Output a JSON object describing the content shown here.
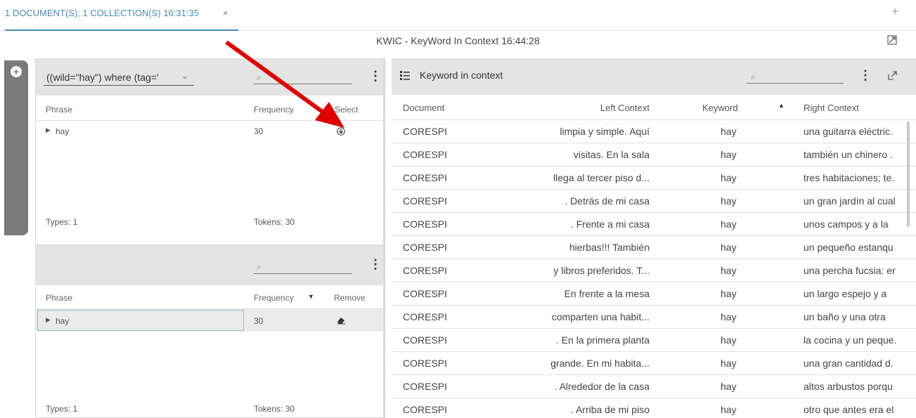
{
  "tab": {
    "label": "1 DOCUMENT(S), 1 COLLECTION(S) 16:31:35",
    "close_symbol": "×",
    "add_symbol": "+"
  },
  "window_title": "KWIC - KeyWord In Context 16:44:28",
  "query_panel": {
    "query_value": "((wild=\"hay\") where (tag='",
    "search_placeholder": "⌕",
    "columns": {
      "phrase": "Phrase",
      "frequency": "Frequency",
      "select": "Select"
    },
    "rows": [
      {
        "phrase": "hay",
        "frequency": "30"
      }
    ],
    "types": "Types: 1",
    "tokens": "Tokens: 30"
  },
  "results_panel": {
    "search_placeholder": "⌕",
    "columns": {
      "phrase": "Phrase",
      "frequency": "Frequency",
      "remove": "Remove"
    },
    "rows": [
      {
        "phrase": "hay",
        "frequency": "30"
      }
    ],
    "types": "Types: 1",
    "tokens": "Tokens: 30"
  },
  "kwic_panel": {
    "title": "Keyword in context",
    "search_placeholder": "⌕",
    "columns": {
      "document": "Document",
      "left": "Left Context",
      "keyword": "Keyword",
      "right": "Right Context"
    },
    "rows": [
      {
        "document": "CORESPI",
        "left": "limpia y simple. Aquí",
        "keyword": "hay",
        "right": "una guitarra eléctric."
      },
      {
        "document": "CORESPI",
        "left": "visitas. En la sala",
        "keyword": "hay",
        "right": "también un chinero ."
      },
      {
        "document": "CORESPI",
        "left": "llega al tercer piso d...",
        "keyword": "hay",
        "right": "tres habitaciones; te."
      },
      {
        "document": "CORESPI",
        "left": ". Detrás de mi casa",
        "keyword": "hay",
        "right": "un gran jardín al cual"
      },
      {
        "document": "CORESPI",
        "left": ". Frente a mi casa",
        "keyword": "hay",
        "right": "unos campos y a la"
      },
      {
        "document": "CORESPI",
        "left": "hierbas!!! También",
        "keyword": "hay",
        "right": "un pequeño estanqu"
      },
      {
        "document": "CORESPI",
        "left": "y libros preferidos. T...",
        "keyword": "hay",
        "right": "una percha fucsia: er"
      },
      {
        "document": "CORESPI",
        "left": "En frente a la mesa",
        "keyword": "hay",
        "right": "un largo espejo y a"
      },
      {
        "document": "CORESPI",
        "left": "comparten una habit...",
        "keyword": "hay",
        "right": "un baño y una otra"
      },
      {
        "document": "CORESPI",
        "left": ". En la primera planta",
        "keyword": "hay",
        "right": "la cocina y un peque."
      },
      {
        "document": "CORESPI",
        "left": "grande. En mi habita...",
        "keyword": "hay",
        "right": "una gran cantidad d."
      },
      {
        "document": "CORESPI",
        "left": ". Alrededor de la casa",
        "keyword": "hay",
        "right": "altos arbustos porqu"
      },
      {
        "document": "CORESPI",
        "left": ". Arriba de mi piso",
        "keyword": "hay",
        "right": "otro que antes era el"
      }
    ]
  },
  "colors": {
    "accent": "#4a8bb3",
    "panel_header": "#e4e4e4",
    "side_panel": "#7a7a7a",
    "arrow": "#e00000"
  },
  "icons": {
    "add_query": "plus-circle-icon",
    "menu": "kebab-menu-icon",
    "list": "list-icon",
    "expand": "expand-icon",
    "select": "arrow-circle-down-icon",
    "remove": "eraser-icon",
    "sort": "sort-icon",
    "chevron": "chevron-down-icon",
    "expand_row": "caret-right-icon"
  }
}
